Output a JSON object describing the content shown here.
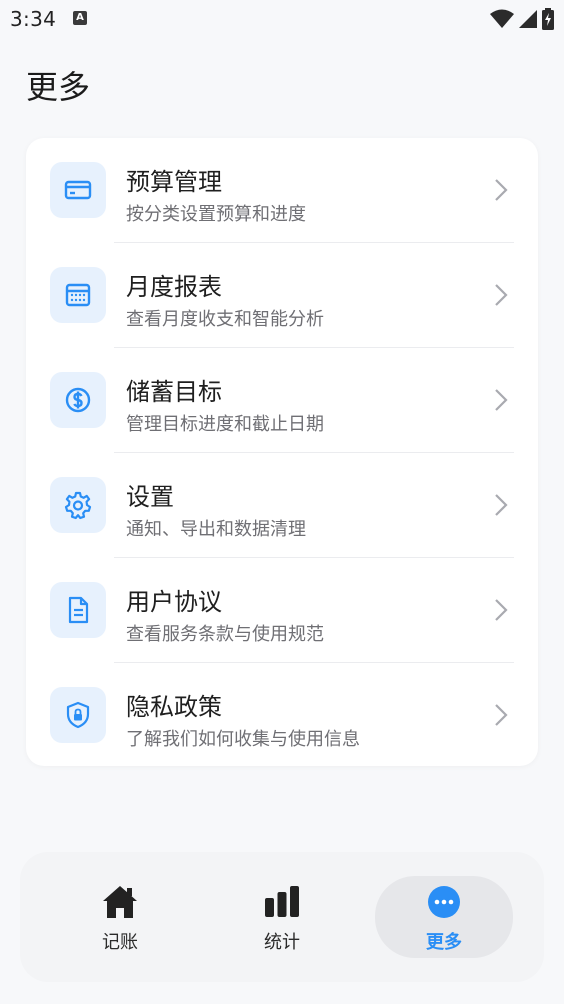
{
  "status_bar": {
    "time": "3:34",
    "notification_glyph": "A"
  },
  "header": {
    "title": "更多"
  },
  "menu": {
    "items": [
      {
        "icon": "card-icon",
        "title": "预算管理",
        "subtitle": "按分类设置预算和进度"
      },
      {
        "icon": "calendar-icon",
        "title": "月度报表",
        "subtitle": "查看月度收支和智能分析"
      },
      {
        "icon": "dollar-icon",
        "title": "储蓄目标",
        "subtitle": "管理目标进度和截止日期"
      },
      {
        "icon": "gear-icon",
        "title": "设置",
        "subtitle": "通知、导出和数据清理"
      },
      {
        "icon": "document-icon",
        "title": "用户协议",
        "subtitle": "查看服务条款与使用规范"
      },
      {
        "icon": "shield-icon",
        "title": "隐私政策",
        "subtitle": "了解我们如何收集与使用信息"
      }
    ]
  },
  "bottom_nav": {
    "items": [
      {
        "icon": "home-icon",
        "label": "记账"
      },
      {
        "icon": "bar-chart-icon",
        "label": "统计"
      },
      {
        "icon": "more-icon",
        "label": "更多",
        "active": true
      }
    ]
  },
  "colors": {
    "accent": "#2a8ef5",
    "icon_bg": "#e7f1fd"
  }
}
